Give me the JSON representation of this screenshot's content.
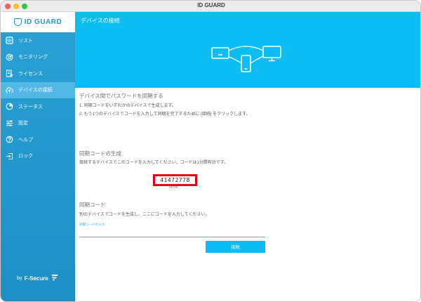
{
  "window": {
    "title": "ID GUARD"
  },
  "logo": {
    "text": "ID GUARD"
  },
  "sidebar": {
    "items": [
      {
        "label": "リスト",
        "icon": "list-icon"
      },
      {
        "label": "モニタリング",
        "icon": "monitoring-icon"
      },
      {
        "label": "ライセンス",
        "icon": "license-icon"
      },
      {
        "label": "デバイスの接続",
        "icon": "cloud-upload-icon",
        "active": true
      },
      {
        "label": "ステータス",
        "icon": "pie-chart-icon"
      },
      {
        "label": "設定",
        "icon": "sliders-icon"
      },
      {
        "label": "ヘルプ",
        "icon": "help-icon"
      },
      {
        "label": "ロック",
        "icon": "lock-exit-icon"
      }
    ],
    "brand": {
      "prefix": "by",
      "name": "F-Secure"
    }
  },
  "banner": {
    "title": "デバイスの接続"
  },
  "sync": {
    "title": "デバイス間でパスワードを同期する",
    "step1": "1. 同期コードをいずれかのデバイスで生成します。",
    "step2": "2. もう1つのデバイスでコードを入力して同期を完了するために [接続] をクリックします。"
  },
  "generate": {
    "title": "同期コードの生成",
    "description": "接続するデバイスでこのコードを入力してください。コードは1分間有効です。",
    "code": "41472778",
    "timer": "00:56"
  },
  "enter_code": {
    "title": "同期コード",
    "description": "別のデバイスでコードを生成し、ここにコードを入力してください。",
    "input_label": "同期コードの入力",
    "input_value": "",
    "button_label": "接続"
  },
  "colors": {
    "sidebar": "#2096c9",
    "sidebar_active": "#52b9e6",
    "banner": "#0cbdf4",
    "code_highlight": "#e3001b"
  }
}
